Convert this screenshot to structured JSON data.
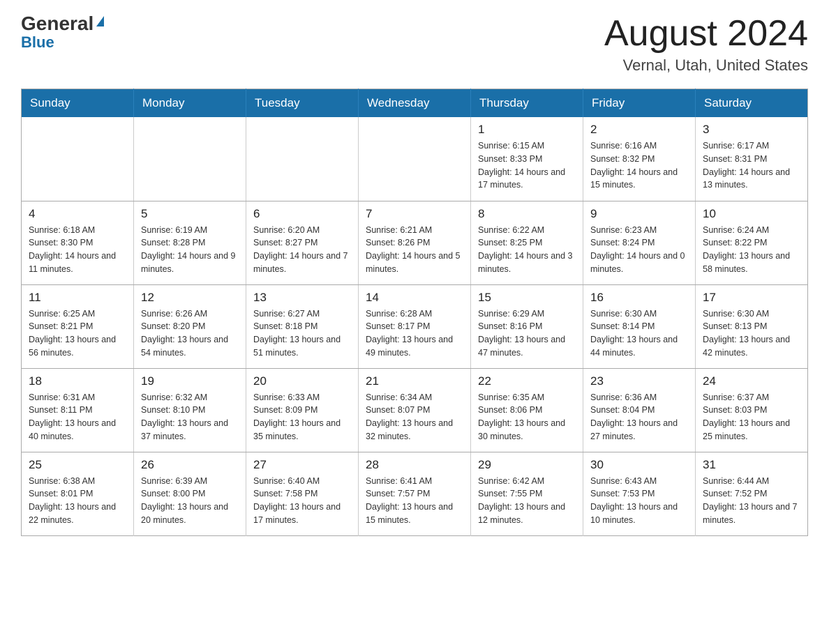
{
  "logo": {
    "general": "General",
    "blue": "Blue",
    "triangle": "▶"
  },
  "title": "August 2024",
  "subtitle": "Vernal, Utah, United States",
  "weekdays": [
    "Sunday",
    "Monday",
    "Tuesday",
    "Wednesday",
    "Thursday",
    "Friday",
    "Saturday"
  ],
  "weeks": [
    [
      {
        "day": "",
        "info": ""
      },
      {
        "day": "",
        "info": ""
      },
      {
        "day": "",
        "info": ""
      },
      {
        "day": "",
        "info": ""
      },
      {
        "day": "1",
        "info": "Sunrise: 6:15 AM\nSunset: 8:33 PM\nDaylight: 14 hours and 17 minutes."
      },
      {
        "day": "2",
        "info": "Sunrise: 6:16 AM\nSunset: 8:32 PM\nDaylight: 14 hours and 15 minutes."
      },
      {
        "day": "3",
        "info": "Sunrise: 6:17 AM\nSunset: 8:31 PM\nDaylight: 14 hours and 13 minutes."
      }
    ],
    [
      {
        "day": "4",
        "info": "Sunrise: 6:18 AM\nSunset: 8:30 PM\nDaylight: 14 hours and 11 minutes."
      },
      {
        "day": "5",
        "info": "Sunrise: 6:19 AM\nSunset: 8:28 PM\nDaylight: 14 hours and 9 minutes."
      },
      {
        "day": "6",
        "info": "Sunrise: 6:20 AM\nSunset: 8:27 PM\nDaylight: 14 hours and 7 minutes."
      },
      {
        "day": "7",
        "info": "Sunrise: 6:21 AM\nSunset: 8:26 PM\nDaylight: 14 hours and 5 minutes."
      },
      {
        "day": "8",
        "info": "Sunrise: 6:22 AM\nSunset: 8:25 PM\nDaylight: 14 hours and 3 minutes."
      },
      {
        "day": "9",
        "info": "Sunrise: 6:23 AM\nSunset: 8:24 PM\nDaylight: 14 hours and 0 minutes."
      },
      {
        "day": "10",
        "info": "Sunrise: 6:24 AM\nSunset: 8:22 PM\nDaylight: 13 hours and 58 minutes."
      }
    ],
    [
      {
        "day": "11",
        "info": "Sunrise: 6:25 AM\nSunset: 8:21 PM\nDaylight: 13 hours and 56 minutes."
      },
      {
        "day": "12",
        "info": "Sunrise: 6:26 AM\nSunset: 8:20 PM\nDaylight: 13 hours and 54 minutes."
      },
      {
        "day": "13",
        "info": "Sunrise: 6:27 AM\nSunset: 8:18 PM\nDaylight: 13 hours and 51 minutes."
      },
      {
        "day": "14",
        "info": "Sunrise: 6:28 AM\nSunset: 8:17 PM\nDaylight: 13 hours and 49 minutes."
      },
      {
        "day": "15",
        "info": "Sunrise: 6:29 AM\nSunset: 8:16 PM\nDaylight: 13 hours and 47 minutes."
      },
      {
        "day": "16",
        "info": "Sunrise: 6:30 AM\nSunset: 8:14 PM\nDaylight: 13 hours and 44 minutes."
      },
      {
        "day": "17",
        "info": "Sunrise: 6:30 AM\nSunset: 8:13 PM\nDaylight: 13 hours and 42 minutes."
      }
    ],
    [
      {
        "day": "18",
        "info": "Sunrise: 6:31 AM\nSunset: 8:11 PM\nDaylight: 13 hours and 40 minutes."
      },
      {
        "day": "19",
        "info": "Sunrise: 6:32 AM\nSunset: 8:10 PM\nDaylight: 13 hours and 37 minutes."
      },
      {
        "day": "20",
        "info": "Sunrise: 6:33 AM\nSunset: 8:09 PM\nDaylight: 13 hours and 35 minutes."
      },
      {
        "day": "21",
        "info": "Sunrise: 6:34 AM\nSunset: 8:07 PM\nDaylight: 13 hours and 32 minutes."
      },
      {
        "day": "22",
        "info": "Sunrise: 6:35 AM\nSunset: 8:06 PM\nDaylight: 13 hours and 30 minutes."
      },
      {
        "day": "23",
        "info": "Sunrise: 6:36 AM\nSunset: 8:04 PM\nDaylight: 13 hours and 27 minutes."
      },
      {
        "day": "24",
        "info": "Sunrise: 6:37 AM\nSunset: 8:03 PM\nDaylight: 13 hours and 25 minutes."
      }
    ],
    [
      {
        "day": "25",
        "info": "Sunrise: 6:38 AM\nSunset: 8:01 PM\nDaylight: 13 hours and 22 minutes."
      },
      {
        "day": "26",
        "info": "Sunrise: 6:39 AM\nSunset: 8:00 PM\nDaylight: 13 hours and 20 minutes."
      },
      {
        "day": "27",
        "info": "Sunrise: 6:40 AM\nSunset: 7:58 PM\nDaylight: 13 hours and 17 minutes."
      },
      {
        "day": "28",
        "info": "Sunrise: 6:41 AM\nSunset: 7:57 PM\nDaylight: 13 hours and 15 minutes."
      },
      {
        "day": "29",
        "info": "Sunrise: 6:42 AM\nSunset: 7:55 PM\nDaylight: 13 hours and 12 minutes."
      },
      {
        "day": "30",
        "info": "Sunrise: 6:43 AM\nSunset: 7:53 PM\nDaylight: 13 hours and 10 minutes."
      },
      {
        "day": "31",
        "info": "Sunrise: 6:44 AM\nSunset: 7:52 PM\nDaylight: 13 hours and 7 minutes."
      }
    ]
  ]
}
